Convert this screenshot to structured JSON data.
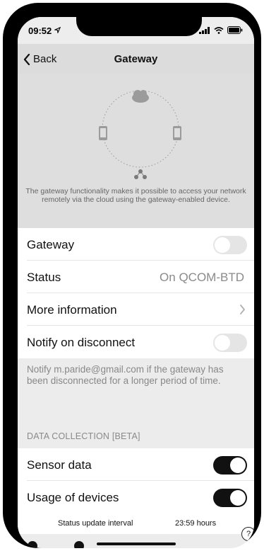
{
  "status_bar": {
    "time": "09:52"
  },
  "nav": {
    "back_label": "Back",
    "title": "Gateway"
  },
  "hero": {
    "description": "The gateway functionality makes it possible to access your network remotely via the cloud using the gateway-enabled device."
  },
  "rows": {
    "gateway": {
      "label": "Gateway",
      "toggle_on": false
    },
    "status": {
      "label": "Status",
      "value": "On QCOM-BTD"
    },
    "more_info": {
      "label": "More information"
    },
    "notify": {
      "label": "Notify on disconnect",
      "toggle_on": false
    }
  },
  "notify_note": "Notify m.paride@gmail.com if the gateway has been disconnected for a longer period of time.",
  "data_collection": {
    "header": "DATA COLLECTION [BETA]",
    "sensor_data": {
      "label": "Sensor data",
      "toggle_on": true
    },
    "usage_of_devices": {
      "label": "Usage of devices",
      "toggle_on": true
    }
  },
  "footer": {
    "label": "Status update interval",
    "value": "23:59 hours"
  },
  "help_label": "?",
  "icons": [
    "location-arrow-icon",
    "signal-icon",
    "wifi-icon",
    "battery-icon",
    "chevron-left-icon",
    "cloud-icon",
    "phone-icon",
    "hub-icon",
    "chevron-right-icon",
    "help-icon"
  ]
}
